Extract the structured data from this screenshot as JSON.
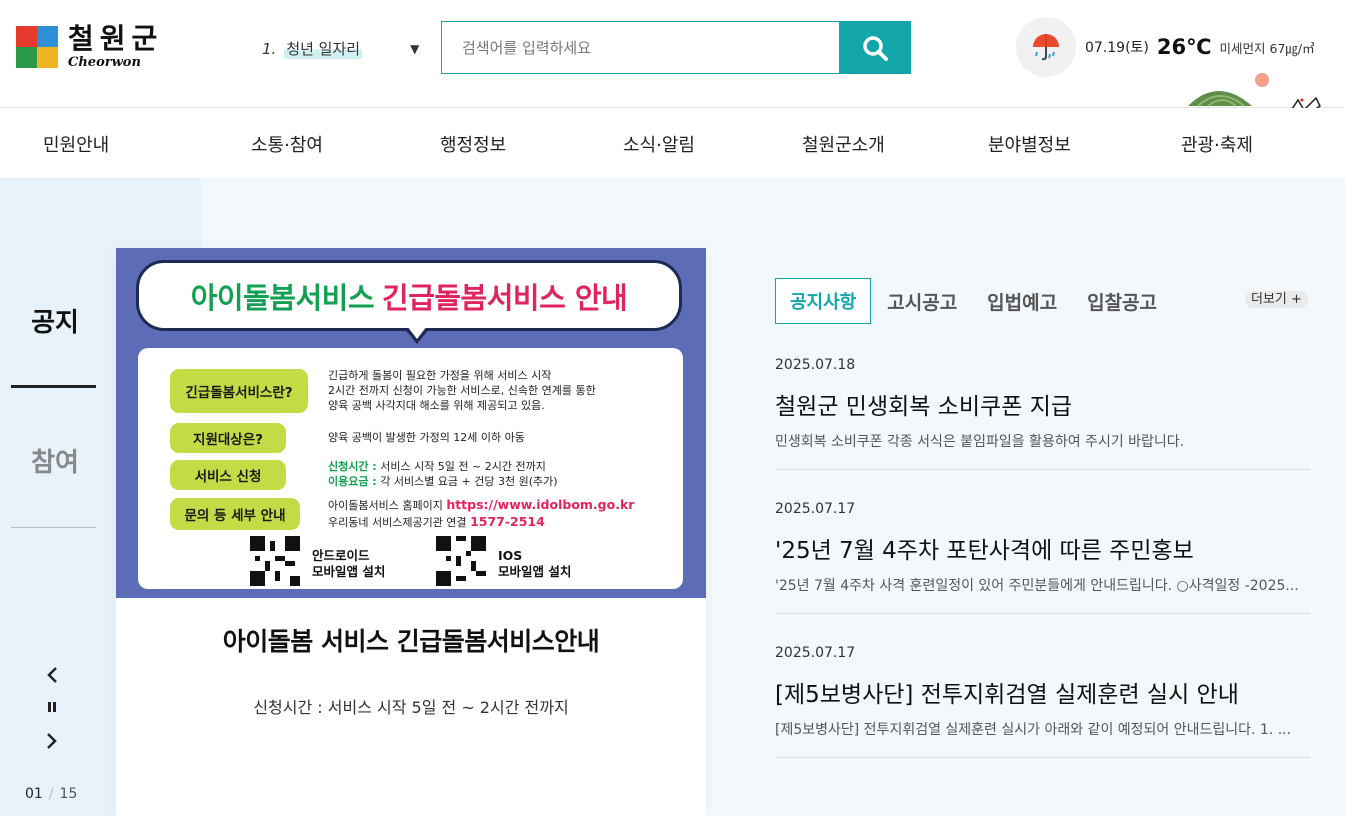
{
  "brand": {
    "name_ko": "철원군",
    "name_en": "Cheorwon"
  },
  "keyword": {
    "rank": "1.",
    "text": "청년 일자리",
    "toggle_icon": "caret-down-icon"
  },
  "search": {
    "placeholder": "검색어를 입력하세요",
    "icon": "search-icon",
    "accent": "#12a6ab"
  },
  "weather": {
    "icon": "umbrella-icon",
    "date": "07.19(토)",
    "temp": "26℃",
    "dust": "미세먼지 67㎍/㎥"
  },
  "nav": {
    "items": [
      "민원안내",
      "소통·참여",
      "행정정보",
      "소식·알림",
      "철원군소개",
      "분야별정보",
      "관광·축제"
    ]
  },
  "side_tabs": {
    "active": "공지",
    "inactive": "참여"
  },
  "slider": {
    "current": "01",
    "total": "15",
    "sep": "/"
  },
  "poster": {
    "headline_green": "아이돌봄서비스",
    "headline_red": "긴급돌봄서비스 안내",
    "rows": [
      {
        "label": "긴급돌봄서비스란?",
        "lines": [
          "긴급하게 돌봄이 필요한 가정을 위해 서비스 시작",
          "2시간 전까지 신청이 가능한 서비스로, 신속한 연계를 통한",
          "양육 공백 사각지대 해소를 위해 제공되고 있음."
        ]
      },
      {
        "label": "지원대상은?",
        "lines": [
          "양육 공백이 발생한 가정의 12세 이하 아동"
        ]
      },
      {
        "label": "서비스 신청",
        "k1": "신청시간 :",
        "v1": " 서비스 시작 5일 전 ~ 2시간 전까지",
        "k2": "이용요금 :",
        "v2": " 각 서비스별 요금 + 건당 3천 원(추가)"
      },
      {
        "label": "문의 등 세부 안내",
        "p1": "아이돌봄서비스 홈페이지 ",
        "url": "https://www.idolbom.go.kr",
        "p2": "우리동네 서비스제공기관 연결 ",
        "phone": "1577-2514"
      }
    ],
    "qr": [
      {
        "line1": "안드로이드",
        "line2": "모바일앱 설치"
      },
      {
        "line1": "IOS",
        "line2": "모바일앱 설치"
      }
    ]
  },
  "card": {
    "title": "아이돌봄 서비스 긴급돌봄서비스안내",
    "subtitle": "신청시간 : 서비스 시작 5일 전 ~ 2시간 전까지"
  },
  "notice_tabs": [
    "공지사항",
    "고시공고",
    "입법예고",
    "입찰공고"
  ],
  "more": "더보기 +",
  "notices": [
    {
      "date": "2025.07.18",
      "title": "철원군 민생회복 소비쿠폰 지급",
      "summary": "민생회복 소비쿠폰 각종 서식은 붙임파일을 활용하여 주시기 바랍니다."
    },
    {
      "date": "2025.07.17",
      "title": "'25년 7월 4주차 포탄사격에 따른 주민홍보",
      "summary": "'25년 7월 4주차 사격 훈련일정이 있어 주민분들에게 안내드립니다. ○사격일정 -2025..."
    },
    {
      "date": "2025.07.17",
      "title": "[제5보병사단] 전투지휘검열 실제훈련 실시 안내",
      "summary": "[제5보병사단] 전투지휘검열 실제훈련 실시가 아래와 같이 예정되어 안내드립니다. 1. ..."
    }
  ]
}
